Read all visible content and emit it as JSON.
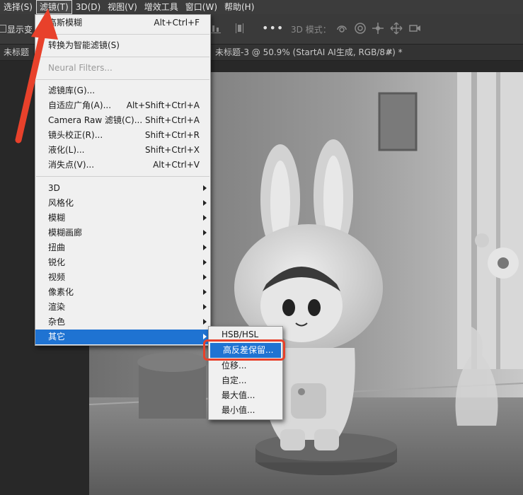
{
  "menubar": {
    "items": [
      {
        "label": "选择(S)",
        "active": false
      },
      {
        "label": "滤镜(T)",
        "active": true
      },
      {
        "label": "3D(D)",
        "active": false
      },
      {
        "label": "视图(V)",
        "active": false
      },
      {
        "label": "增效工具",
        "active": false
      },
      {
        "label": "窗口(W)",
        "active": false
      },
      {
        "label": "帮助(H)",
        "active": false
      }
    ]
  },
  "options": {
    "show_label": "显示变",
    "more": "•••",
    "mode_3d": "3D 模式："
  },
  "tabs": {
    "first": "未标题",
    "second": "未标题-3 @ 50.9% (StartAI AI生成, RGB/8#) *",
    "close": "✕"
  },
  "filter_menu": {
    "items": [
      {
        "label": "高斯模糊",
        "shortcut": "Alt+Ctrl+F"
      },
      {
        "label": "转换为智能滤镜(S)",
        "shortcut": ""
      },
      {
        "label": "Neural Filters...",
        "shortcut": ""
      },
      {
        "label": "滤镜库(G)...",
        "shortcut": ""
      },
      {
        "label": "自适应广角(A)...",
        "shortcut": "Alt+Shift+Ctrl+A"
      },
      {
        "label": "Camera Raw 滤镜(C)...",
        "shortcut": "Shift+Ctrl+A"
      },
      {
        "label": "镜头校正(R)...",
        "shortcut": "Shift+Ctrl+R"
      },
      {
        "label": "液化(L)...",
        "shortcut": "Shift+Ctrl+X"
      },
      {
        "label": "消失点(V)...",
        "shortcut": "Alt+Ctrl+V"
      },
      {
        "label": "3D"
      },
      {
        "label": "风格化"
      },
      {
        "label": "模糊"
      },
      {
        "label": "模糊画廊"
      },
      {
        "label": "扭曲"
      },
      {
        "label": "锐化"
      },
      {
        "label": "视频"
      },
      {
        "label": "像素化"
      },
      {
        "label": "渲染"
      },
      {
        "label": "杂色"
      },
      {
        "label": "其它"
      }
    ]
  },
  "other_submenu": {
    "items": [
      {
        "label": "HSB/HSL"
      },
      {
        "label": "高反差保留..."
      },
      {
        "label": "位移..."
      },
      {
        "label": "自定..."
      },
      {
        "label": "最大值..."
      },
      {
        "label": "最小值..."
      }
    ]
  },
  "colors": {
    "highlight": "#1f73d2",
    "annotation": "#e8412b"
  }
}
